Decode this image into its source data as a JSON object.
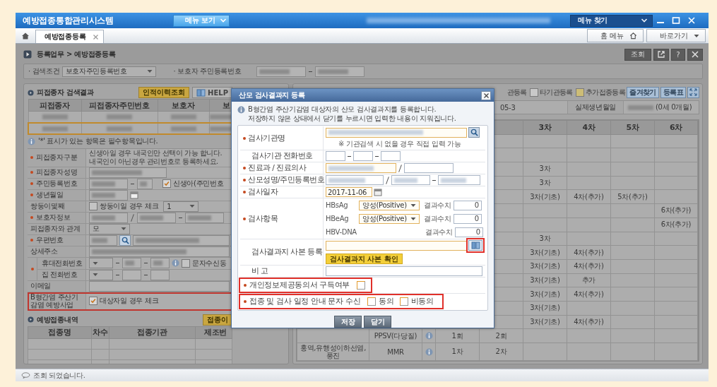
{
  "app": {
    "title": "예방접종통합관리시스템",
    "menu_button": "메뉴 보기",
    "menu_search": "메뉴 찾기"
  },
  "tabs": [
    {
      "label": "예방접종등록",
      "selected": true
    }
  ],
  "tab_links": [
    {
      "label": "홈 메뉴",
      "kind": "home"
    },
    {
      "label": "바로가기",
      "kind": "caret"
    }
  ],
  "breadcrumb": "등록업무 > 예방접종등록",
  "toolbar_buttons": [
    {
      "kind": "text",
      "label": "조회"
    },
    {
      "kind": "popout"
    },
    {
      "kind": "text",
      "label": "?"
    },
    {
      "kind": "close"
    }
  ],
  "search": {
    "condition_label": "· 검색조건",
    "condition_value": "보호자주민등록번호",
    "guardian_label": "· 보호자 주민등록번호"
  },
  "result_section": {
    "title": "피접종자 검색결과",
    "buttons": [
      {
        "label": "인적이력조회",
        "kind": "highlight"
      },
      {
        "label": "HELP",
        "kind": "help"
      }
    ],
    "columns": [
      "피접종자",
      "피접종자주민번호",
      "보호자",
      "보"
    ],
    "rows": [
      {
        "selected": false
      },
      {
        "selected": true
      }
    ]
  },
  "required_note": "'*' 표시가 있는 항목은 필수항목입니다.",
  "form_rows": [
    {
      "kind": "note",
      "label": "피접종자구분",
      "required": true,
      "lines": [
        "신생아일 경우 내국인만 선택이 가능 합니다.",
        "내국인이 아닌경우 관리번호로 등록하세요."
      ]
    },
    {
      "kind": "blurred",
      "label": "피접종자성명",
      "required": true
    },
    {
      "kind": "ssn",
      "label": "주민등록번호",
      "required": true,
      "checkbox": {
        "label": "신생아(주민번호",
        "checked": true
      }
    },
    {
      "kind": "date",
      "label": "생년월일",
      "required": true
    },
    {
      "kind": "twin",
      "label": "쌍둥이몇째",
      "required": false,
      "checkbox": {
        "label": "쌍둥이일 경우 체크",
        "checked": false
      },
      "select": "1"
    },
    {
      "kind": "guardian",
      "label": "보호자정보",
      "required": true
    },
    {
      "kind": "select",
      "label": "피접종자와 관계",
      "required": false,
      "select": "모"
    },
    {
      "kind": "postal",
      "label": "우편번호",
      "required": true
    },
    {
      "kind": "wide",
      "label": "상세주소",
      "required": false
    },
    {
      "kind": "phones",
      "required": true,
      "lines": [
        {
          "label": "휴대전화번호",
          "kind": "mobile",
          "checkbox": {
            "label": "문자수신동",
            "checked": false
          }
        },
        {
          "label": "집 전화번호",
          "kind": "home"
        }
      ]
    },
    {
      "kind": "text",
      "label": "이메일",
      "required": false
    },
    {
      "kind": "hepb",
      "label": "B형간염 주산기 감염 예방사업",
      "required": false,
      "highlighted": true,
      "checkbox": {
        "label": "대상자일 경우 체크",
        "checked": true
      }
    }
  ],
  "history_section": {
    "title": "예방접종내역",
    "button": "접종이",
    "columns": [
      "접종명",
      "차수",
      "접종기관",
      "제조번"
    ]
  },
  "right_panel": {
    "legend": [
      {
        "label": "관등록"
      },
      {
        "label": "타기관등록",
        "color": "#c9c9c9"
      },
      {
        "label": "추가접종등록",
        "color": "#cdbd76"
      }
    ],
    "buttons": [
      "즐겨찾기",
      "등록표"
    ],
    "info": {
      "partial": "05-3",
      "label": "실제생년월일",
      "age": "(0세 0개월)"
    },
    "columns": [
      "3차",
      "4차",
      "5차",
      "6차"
    ],
    "rows": [
      {},
      {},
      {
        "dose_3": "3차"
      },
      {
        "dose_3": "3차"
      },
      {
        "dose_3": "3차(기초)",
        "dose_4": "4차(추가)",
        "dose_5": "5차(추가)"
      },
      {
        "dose_6": "6차(추가)"
      },
      {
        "dose_6": "6차(추가)"
      },
      {
        "dose_3": "3차"
      },
      {
        "dose_3": "3차(기초)",
        "dose_4": "4차(추가)"
      },
      {
        "dose_3": "3차(기초)",
        "dose_4": "4차(추가)"
      },
      {
        "dose_3": "3차(기초)",
        "dose_4": "추가"
      },
      {
        "dose_3": "3차(기초)",
        "dose_4": "4차(추가)"
      },
      {
        "dose_3": "3차(기초)"
      },
      {
        "dose_3": "3차(기초)",
        "dose_4": "4차(추가)"
      },
      {
        "vaccine": "PPSV(다당질)",
        "info": true,
        "dose_1": "1회",
        "dose_2": "2회"
      },
      {
        "disease": "홍역,유행성이하선염,풍진",
        "vaccine": "MMR",
        "info": true,
        "dose_1": "1차",
        "dose_2": "2차"
      }
    ]
  },
  "dialog": {
    "title": "산모 검사결과지 등록",
    "notice": [
      "B형간염 주산기감염 대상자의 산모 검사결과지를 등록합니다.",
      "저장하지 않은 상태에서 닫기를 누르시면 입력한 내용이 지워집니다."
    ],
    "rows": [
      {
        "kind": "institution",
        "label": "검사기관명",
        "required": true,
        "hint": "※ 기관검색 시 없을 경우 직접 입력 가능"
      },
      {
        "kind": "phone",
        "label": "검사기관 전화번호",
        "required": false
      },
      {
        "kind": "doctor",
        "label": "진료과 / 진료의사",
        "required": true
      },
      {
        "kind": "mother",
        "label": "산모성명/주민등록번호",
        "required": true
      },
      {
        "kind": "date",
        "label": "검사일자",
        "required": true,
        "value": "2017-11-06"
      },
      {
        "kind": "tests",
        "label": "검사항목",
        "required": true,
        "tests": [
          {
            "name": "HBsAg",
            "select": "양성(Positive)",
            "result_label": "결과수치",
            "result": "0"
          },
          {
            "name": "HBeAg",
            "select": "양성(Positive)",
            "result_label": "결과수치",
            "result": "0"
          },
          {
            "name": "HBV-DNA",
            "result_label": "결과수치",
            "result": "0"
          }
        ]
      },
      {
        "kind": "file",
        "label": "검사결과지 사본 등록",
        "required": false,
        "highlighted": true,
        "button": "검사결과지 사본 확인"
      },
      {
        "kind": "memo",
        "label": "비 고",
        "required": false
      }
    ],
    "consents": [
      {
        "label": "개인정보제공동의서 구득여부",
        "required": true,
        "highlighted": true,
        "options": [
          {
            "checked": false
          }
        ]
      },
      {
        "label": "접종 및 검사 일정 안내 문자 수신",
        "required": true,
        "highlighted": true,
        "options": [
          {
            "label": "동의",
            "checked": false
          },
          {
            "label": "비동의",
            "checked": false
          }
        ]
      }
    ],
    "buttons": [
      "저장",
      "닫기"
    ]
  },
  "status": "조회 되었습니다."
}
